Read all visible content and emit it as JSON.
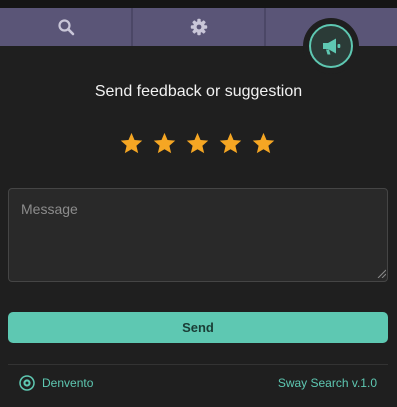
{
  "tabs": [
    {
      "icon": "search-icon"
    },
    {
      "icon": "gear-icon"
    },
    {
      "icon": "megaphone-icon",
      "active": true
    }
  ],
  "feedback": {
    "title": "Send feedback or suggestion",
    "rating": {
      "stars": 5,
      "selected": 5,
      "color": "#f5a623"
    },
    "message_placeholder": "Message",
    "message_value": "",
    "send_label": "Send"
  },
  "footer": {
    "brand_label": "Denvento",
    "brand_icon": "denvento-logo-icon",
    "version_label": "Sway Search v.1.0"
  },
  "colors": {
    "accent": "#5ec8b2",
    "tabbar": "#5a5577",
    "background": "#1f1f1f"
  }
}
